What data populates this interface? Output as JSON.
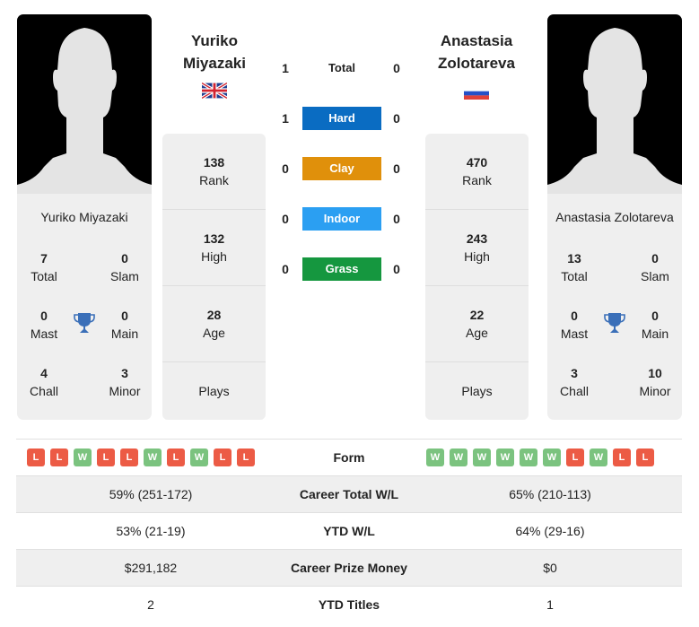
{
  "players": [
    {
      "name": "Yuriko Miyazaki",
      "name_line1": "Yuriko",
      "name_line2": "Miyazaki",
      "flag": "gb-flag",
      "titles": {
        "total": "7",
        "total_label": "Total",
        "slam": "0",
        "slam_label": "Slam",
        "mast": "0",
        "mast_label": "Mast",
        "main": "0",
        "main_label": "Main",
        "chall": "4",
        "chall_label": "Chall",
        "minor": "3",
        "minor_label": "Minor"
      },
      "stats": {
        "rank": "138",
        "rank_label": "Rank",
        "high": "132",
        "high_label": "High",
        "age": "28",
        "age_label": "Age",
        "plays_label": "Plays"
      },
      "form": [
        "L",
        "L",
        "W",
        "L",
        "L",
        "W",
        "L",
        "W",
        "L",
        "L"
      ]
    },
    {
      "name": "Anastasia Zolotareva",
      "name_line1": "Anastasia",
      "name_line2": "Zolotareva",
      "flag": "ru-flag",
      "titles": {
        "total": "13",
        "total_label": "Total",
        "slam": "0",
        "slam_label": "Slam",
        "mast": "0",
        "mast_label": "Mast",
        "main": "0",
        "main_label": "Main",
        "chall": "3",
        "chall_label": "Chall",
        "minor": "10",
        "minor_label": "Minor"
      },
      "stats": {
        "rank": "470",
        "rank_label": "Rank",
        "high": "243",
        "high_label": "High",
        "age": "22",
        "age_label": "Age",
        "plays_label": "Plays"
      },
      "form": [
        "W",
        "W",
        "W",
        "W",
        "W",
        "W",
        "L",
        "W",
        "L",
        "L"
      ]
    }
  ],
  "h2h": [
    {
      "label": "Total",
      "left": "1",
      "right": "0",
      "color": ""
    },
    {
      "label": "Hard",
      "left": "1",
      "right": "0",
      "color": "#0a6cc2"
    },
    {
      "label": "Clay",
      "left": "0",
      "right": "0",
      "color": "#e0900b"
    },
    {
      "label": "Indoor",
      "left": "0",
      "right": "0",
      "color": "#2b9ff2"
    },
    {
      "label": "Grass",
      "left": "0",
      "right": "0",
      "color": "#15973f"
    }
  ],
  "form_label": "Form",
  "comparison": [
    {
      "label": "Career Total W/L",
      "left": "59% (251-172)",
      "right": "65% (210-113)"
    },
    {
      "label": "YTD W/L",
      "left": "53% (21-19)",
      "right": "64% (29-16)"
    },
    {
      "label": "Career Prize Money",
      "left": "$291,182",
      "right": "$0"
    },
    {
      "label": "YTD Titles",
      "left": "2",
      "right": "1"
    }
  ],
  "colors": {
    "win": "#7bc37f",
    "loss": "#ec5b45",
    "trophy": "#3a6fb8"
  }
}
